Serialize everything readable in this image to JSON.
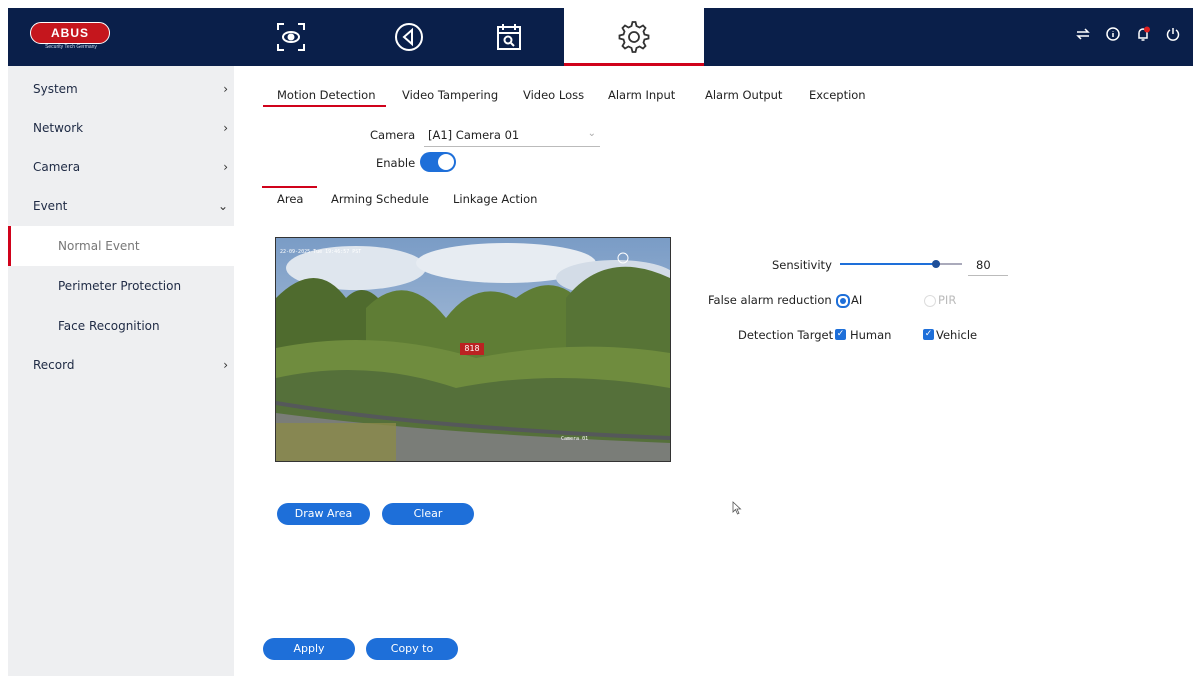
{
  "logo": {
    "text": "ABUS",
    "subtext": "Security Tech Germany"
  },
  "topbar": {
    "icons": [
      "live-view-icon",
      "playback-icon",
      "search-calendar-icon",
      "settings-gear-icon"
    ],
    "right_icons": [
      "transfer-icon",
      "info-icon",
      "notification-bell-icon",
      "power-icon"
    ],
    "colors": {
      "bar": "#0a1f4a",
      "active_underline": "#d0021b"
    }
  },
  "sidebar": {
    "items": [
      {
        "label": "System",
        "chevron": "›"
      },
      {
        "label": "Network",
        "chevron": "›"
      },
      {
        "label": "Camera",
        "chevron": "›"
      },
      {
        "label": "Event",
        "chevron": "⌄"
      },
      {
        "label": "Normal Event"
      },
      {
        "label": "Perimeter Protection"
      },
      {
        "label": "Face Recognition"
      },
      {
        "label": "Record",
        "chevron": "›"
      }
    ]
  },
  "tabs": [
    "Motion Detection",
    "Video Tampering",
    "Video Loss",
    "Alarm Input",
    "Alarm Output",
    "Exception"
  ],
  "form": {
    "camera_label": "Camera",
    "camera_value": "[A1] Camera 01",
    "enable_label": "Enable",
    "enable_on": true
  },
  "subtabs": [
    "Area",
    "Arming Schedule",
    "Linkage Action"
  ],
  "preview": {
    "osd_date": "22-09-2025 Tue 19:46:57 PST",
    "osd_name": "Camera 01",
    "center_label": "818"
  },
  "settings": {
    "sensitivity_label": "Sensitivity",
    "sensitivity_value": "80",
    "false_alarm_label": "False alarm reduction",
    "false_alarm_ai": "AI",
    "false_alarm_pir": "PIR",
    "detection_target_label": "Detection Target",
    "target_human": "Human",
    "target_vehicle": "Vehicle",
    "check_mark": "✓"
  },
  "buttons": {
    "draw_area": "Draw Area",
    "clear": "Clear",
    "apply": "Apply",
    "copy_to": "Copy to"
  },
  "accent": "#1e6fd9"
}
